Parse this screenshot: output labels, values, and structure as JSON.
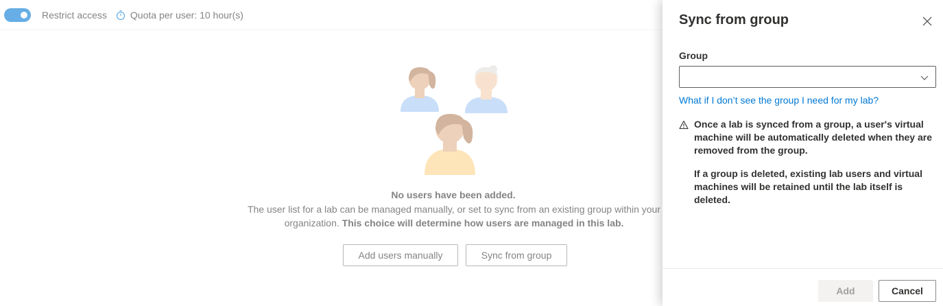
{
  "toolbar": {
    "restrict_access_label": "Restrict access",
    "restrict_access_on": true,
    "quota_label": "Quota per user: 10 hour(s)"
  },
  "empty_state": {
    "title": "No users have been added.",
    "description_plain": "The user list for a lab can be managed manually, or set to sync from an existing group within your organization.",
    "description_bold": "This choice will determine how users are managed in this lab.",
    "add_manually_label": "Add users manually",
    "sync_group_label": "Sync from group"
  },
  "panel": {
    "title": "Sync from group",
    "group_label": "Group",
    "group_value": "",
    "help_link": "What if I don’t see the group I need for my lab?",
    "warning_1": "Once a lab is synced from a group, a user's virtual machine will be automatically deleted when they are removed from the group.",
    "warning_2": "If a group is deleted, existing lab users and virtual machines will be retained until the lab itself is deleted.",
    "add_label": "Add",
    "cancel_label": "Cancel"
  },
  "colors": {
    "accent": "#0078d4",
    "person_shirt_blue": "#a6c8f5",
    "person_shirt_yellow": "#fdd48a",
    "skin": "#e2b38c",
    "hair_brown": "#b58360"
  }
}
